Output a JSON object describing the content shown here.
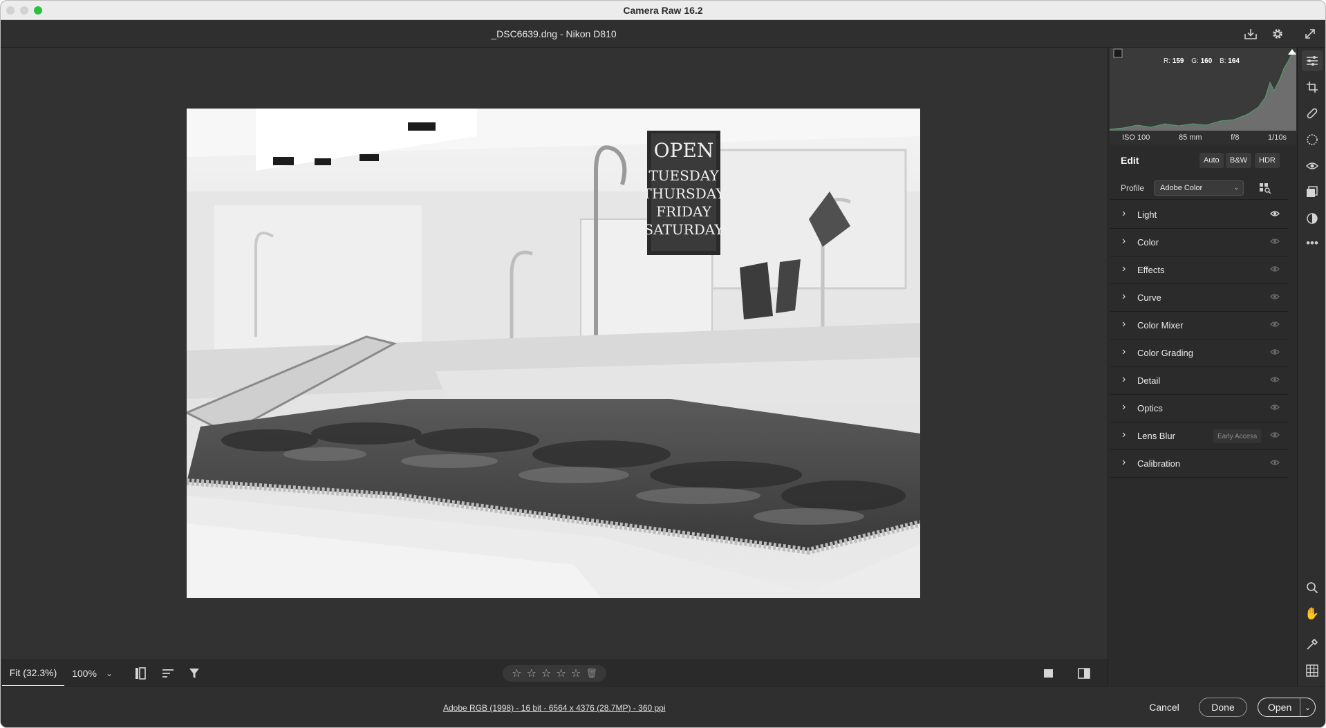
{
  "window": {
    "title": "Camera Raw 16.2"
  },
  "document": {
    "title": "_DSC6639.dng  -  Nikon D810"
  },
  "top_icons": [
    {
      "name": "save-icon",
      "glyph": "⤓"
    },
    {
      "name": "gear-icon",
      "glyph": "⚙"
    },
    {
      "name": "fullscreen-icon",
      "glyph": "⤢"
    }
  ],
  "histogram": {
    "r_label": "R:",
    "r_value": "159",
    "g_label": "G:",
    "g_value": "160",
    "b_label": "B:",
    "b_value": "164"
  },
  "exif": {
    "iso": "ISO 100",
    "focal": "85 mm",
    "aperture": "f/8",
    "shutter": "1/10s"
  },
  "edit": {
    "title": "Edit",
    "auto_label": "Auto",
    "bw_label": "B&W",
    "hdr_label": "HDR",
    "profile_label": "Profile",
    "profile_value": "Adobe Color"
  },
  "sections": [
    {
      "label": "Light",
      "eye_on": true
    },
    {
      "label": "Color",
      "eye_on": false
    },
    {
      "label": "Effects",
      "eye_on": false
    },
    {
      "label": "Curve",
      "eye_on": false
    },
    {
      "label": "Color Mixer",
      "eye_on": false
    },
    {
      "label": "Color Grading",
      "eye_on": false
    },
    {
      "label": "Detail",
      "eye_on": false
    },
    {
      "label": "Optics",
      "eye_on": false
    },
    {
      "label": "Lens Blur",
      "eye_on": false,
      "badge": "Early Access"
    },
    {
      "label": "Calibration",
      "eye_on": false
    }
  ],
  "toolbar": {
    "zoom_fit": "Fit (32.3%)",
    "zoom_100": "100%",
    "rating_stars": 0
  },
  "footer": {
    "file_info": "Adobe RGB (1998) - 16 bit - 6564 x 4376 (28.7MP) - 360 ppi",
    "cancel_label": "Cancel",
    "done_label": "Done",
    "open_label": "Open"
  },
  "photo": {
    "sign_line1": "OPEN",
    "sign_line2": "TUESDAY",
    "sign_line3": "THURSDAY",
    "sign_line4": "FRIDAY",
    "sign_line5": "SATURDAY"
  }
}
